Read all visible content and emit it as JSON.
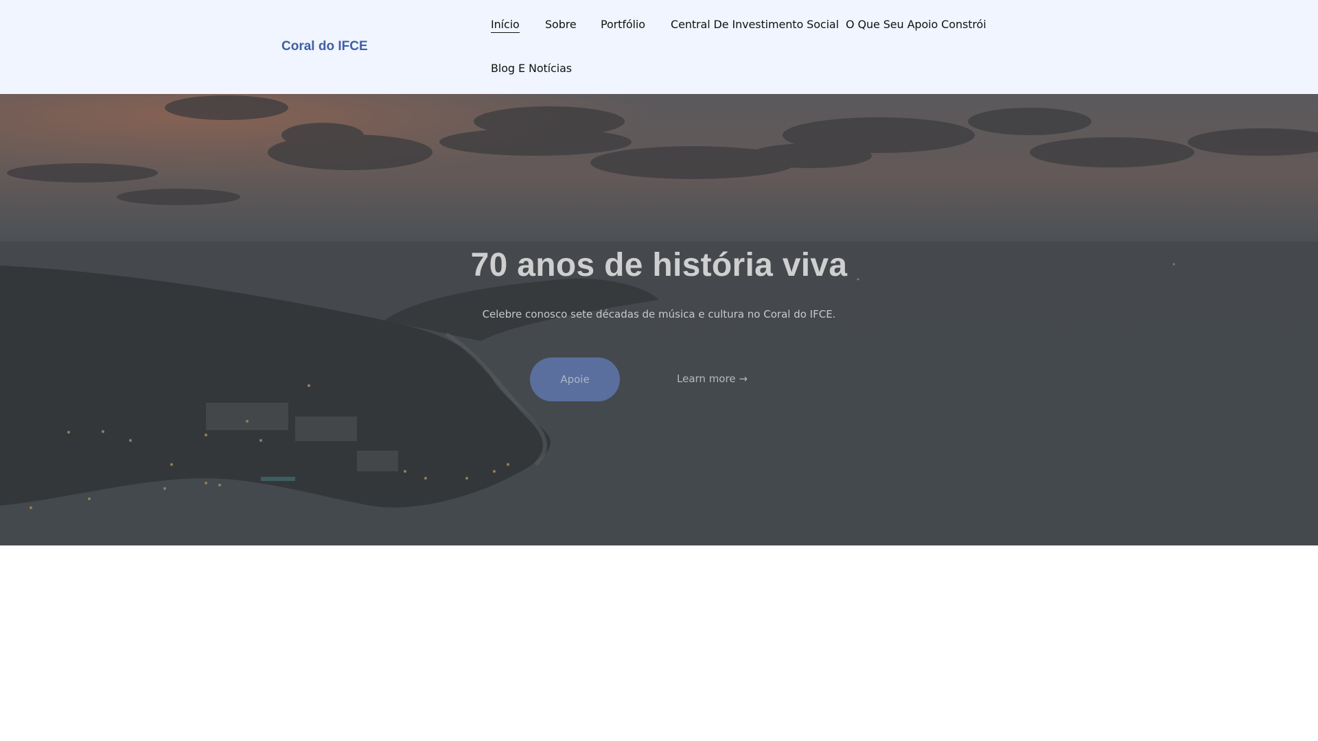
{
  "header": {
    "brand": "Coral do IFCE",
    "nav": [
      {
        "label": "Início",
        "active": true
      },
      {
        "label": "Sobre"
      },
      {
        "label": "Portfólio"
      },
      {
        "label": "Central De Investimento Social"
      },
      {
        "label": "O Que Seu Apoio Constrói"
      },
      {
        "label": "Blog E Notícias"
      }
    ]
  },
  "hero": {
    "title": "70 anos de história viva",
    "subtitle": "Celebre conosco sete décadas de música e cultura no Coral do IFCE.",
    "primary_cta": "Apoie",
    "secondary_cta": "Learn more →"
  },
  "colors": {
    "header_bg": "#f0f5ff",
    "brand": "#3f5fa6",
    "button": "#5a6f9e"
  }
}
